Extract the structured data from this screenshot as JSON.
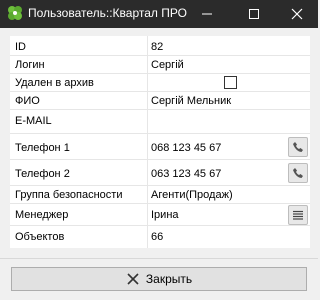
{
  "window": {
    "title": "Пользователь::Квартал ПРО",
    "icon": "clover-icon",
    "controls": [
      "minimize-icon",
      "maximize-icon",
      "close-icon"
    ]
  },
  "fields": {
    "id": {
      "label": "ID",
      "value": "82"
    },
    "login": {
      "label": "Логин",
      "value": "Сергій"
    },
    "archived": {
      "label": "Удален в архив",
      "checked": false
    },
    "fio": {
      "label": "ФИО",
      "value": "Сергій Мельник"
    },
    "email": {
      "label": "E-MAIL",
      "value": ""
    },
    "phone1": {
      "label": "Телефон 1",
      "value": "068 123 45 67",
      "action_icon": "phone-icon"
    },
    "phone2": {
      "label": "Телефон 2",
      "value": "063 123 45 67",
      "action_icon": "phone-icon"
    },
    "security_group": {
      "label": "Группа безопасности",
      "value": "Агенти(Продаж)"
    },
    "manager": {
      "label": "Менеджер",
      "value": "Ірина",
      "action_icon": "list-icon"
    },
    "objects": {
      "label": "Объектов",
      "value": "66"
    }
  },
  "footer": {
    "close_label": "Закрыть",
    "close_icon": "x-icon"
  },
  "colors": {
    "titlebar": "#2b2b2b",
    "panel": "#ffffff",
    "background": "#f0f0f0",
    "button": "#e1e1e1"
  }
}
